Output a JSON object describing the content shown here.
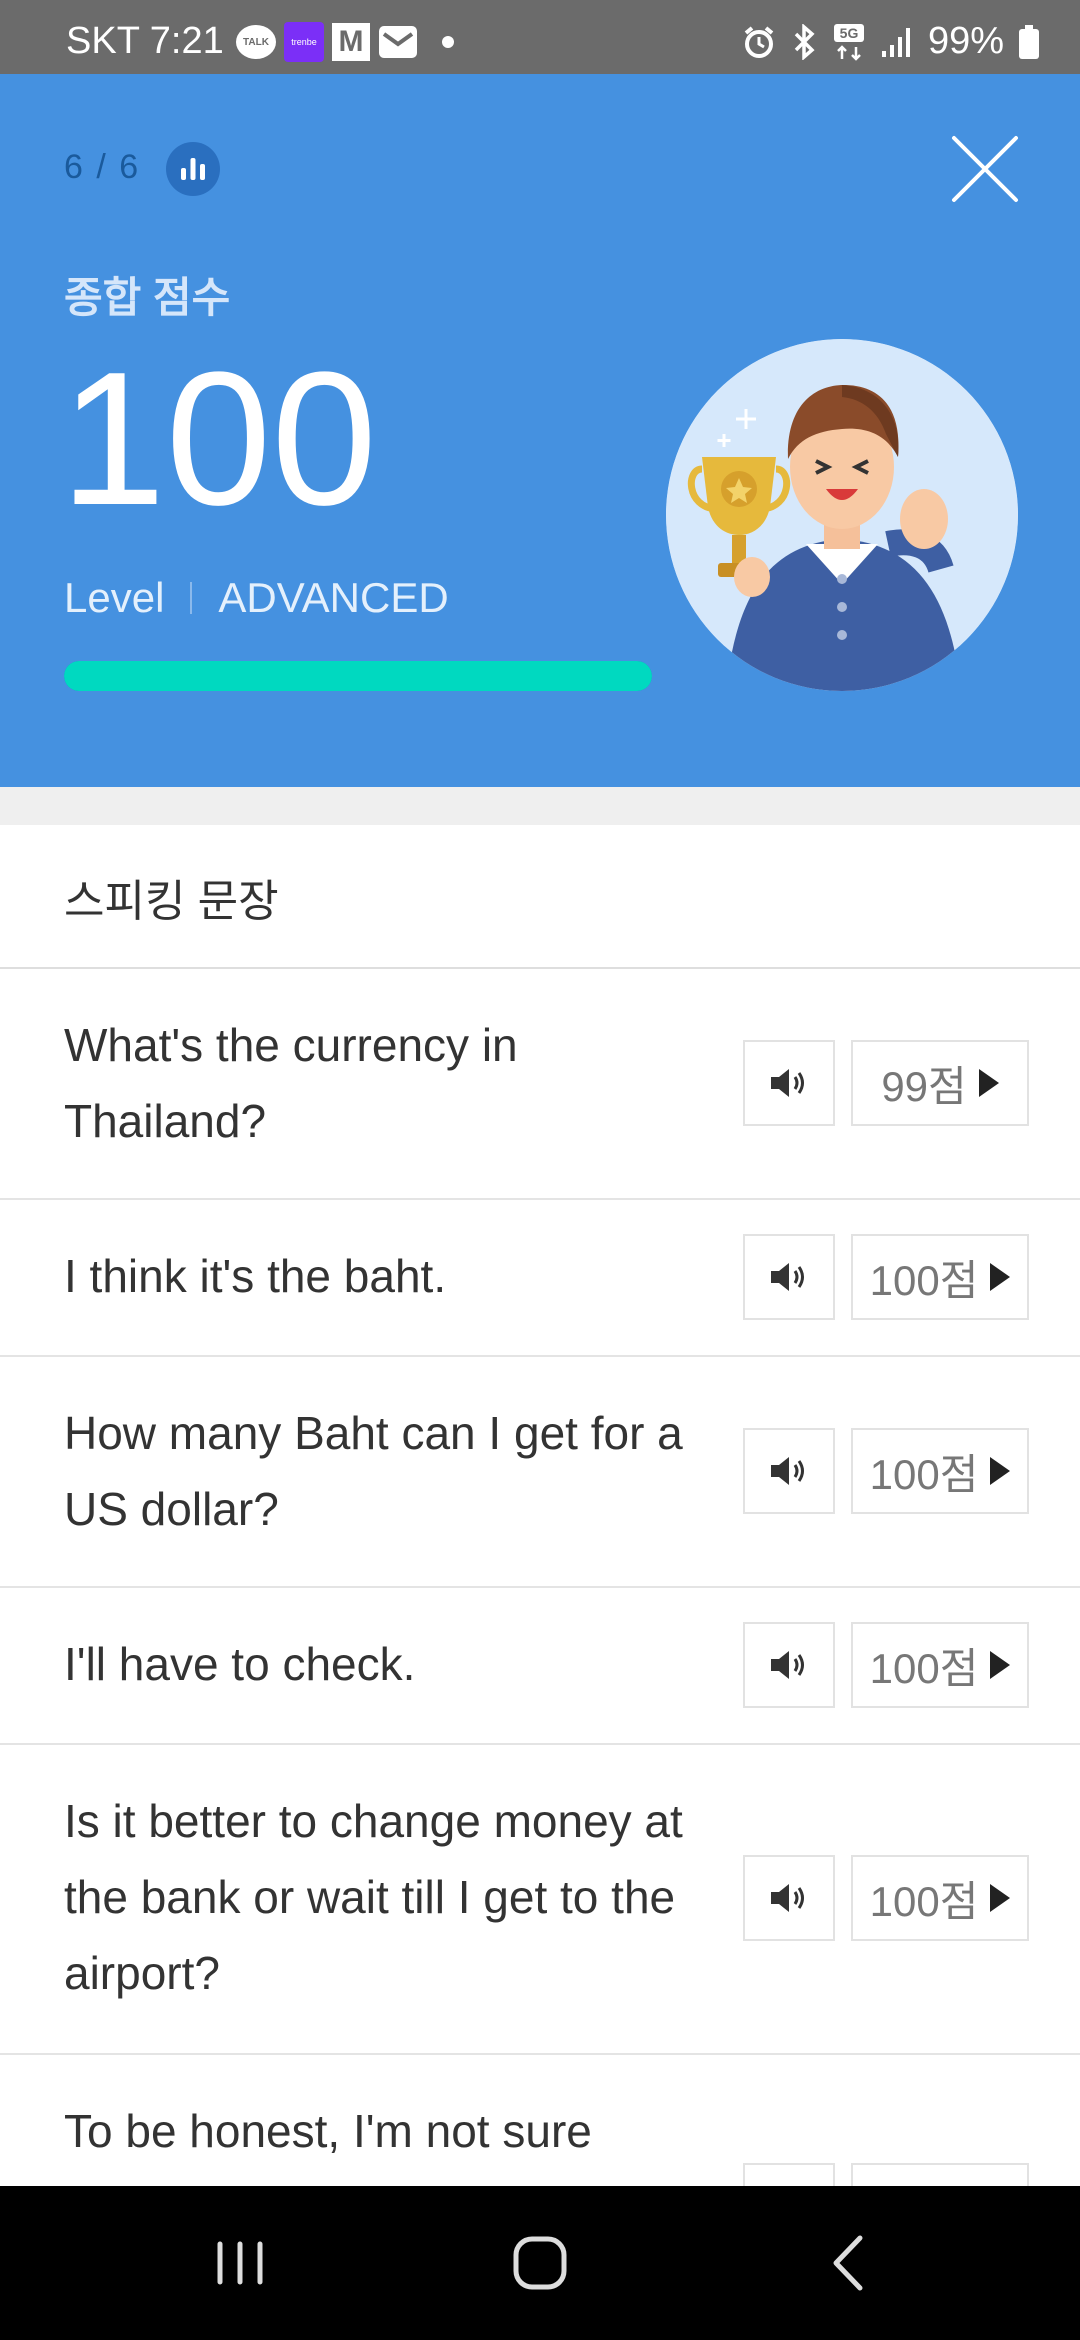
{
  "status_bar": {
    "carrier_time": "SKT 7:21",
    "notif_talk": "TALK",
    "notif_trenbe": "trenbe",
    "notif_m": "M",
    "battery": "99%"
  },
  "hero": {
    "progress": "6 / 6",
    "score_label": "종합 점수",
    "score": "100",
    "level_label": "Level",
    "level_value": "ADVANCED",
    "progress_fraction": 1.0,
    "colors": {
      "background": "#4591e0",
      "progress_fill": "#00d9c0"
    }
  },
  "section": {
    "title": "스피킹 문장"
  },
  "sentences": [
    {
      "text": "What's the currency in Thailand?",
      "score": "99점"
    },
    {
      "text": "I think it's the baht.",
      "score": "100점"
    },
    {
      "text": "How many Baht can I get for a US dollar?",
      "score": "100점"
    },
    {
      "text": "I'll have to check.",
      "score": "100점"
    },
    {
      "text": "Is it better to change money at the bank or wait till I get to the airport?",
      "score": "100점"
    },
    {
      "text": "To be honest, I'm not sure",
      "score": ""
    }
  ]
}
